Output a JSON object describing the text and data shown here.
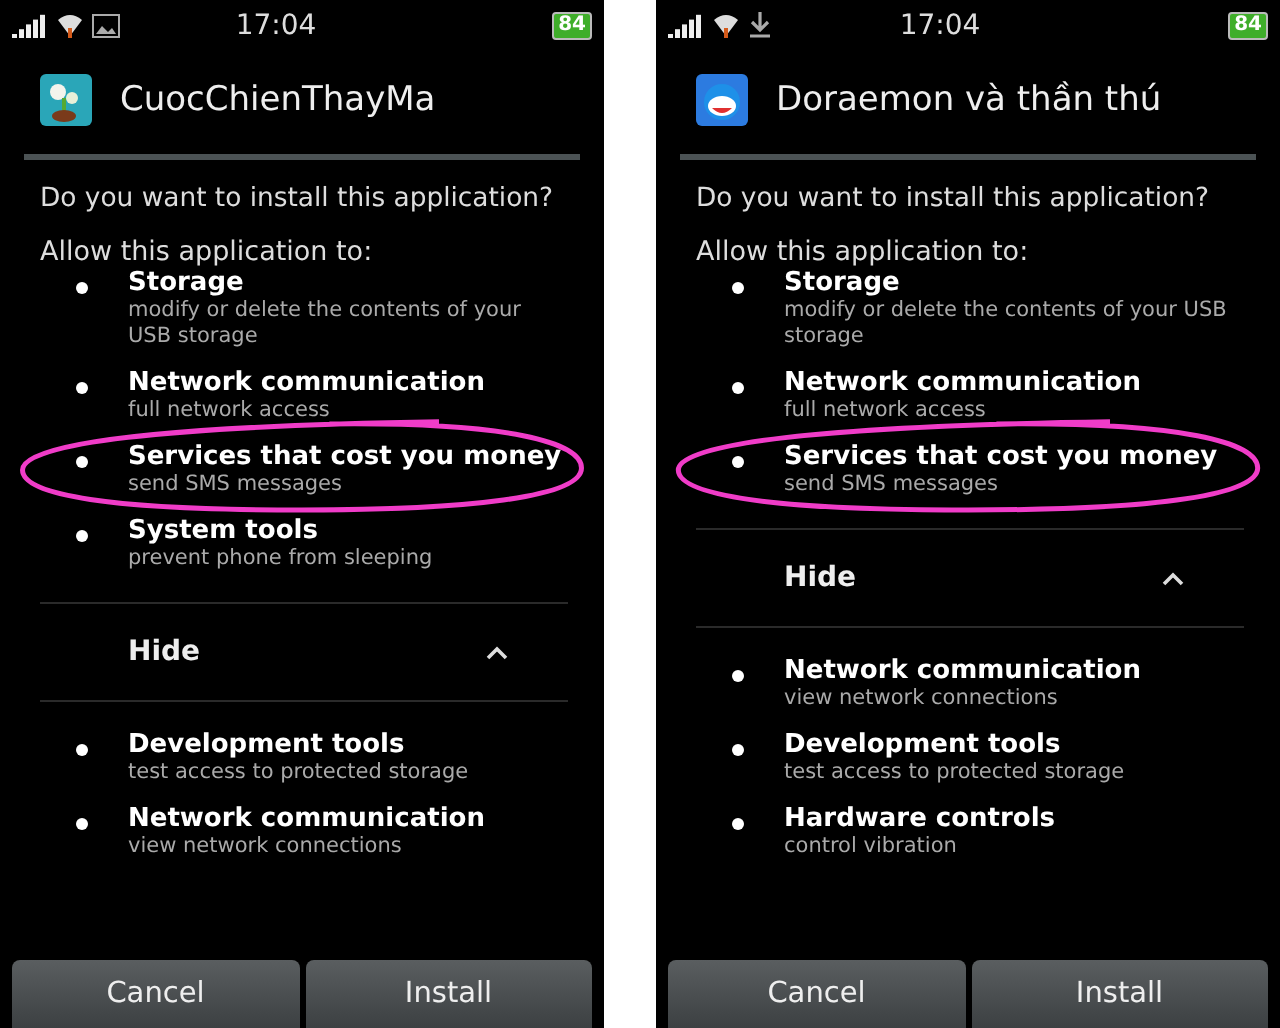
{
  "phones": [
    {
      "status_bar": {
        "time": "17:04",
        "battery": "84"
      },
      "app": {
        "name": "CuocChienThayMa"
      },
      "question": "Do you want to install this application?",
      "allow_label": "Allow this application to:",
      "permissions": [
        {
          "title": "Storage",
          "description": "modify or delete the contents of your USB storage",
          "circled": false
        },
        {
          "title": "Network communication",
          "description": "full network access",
          "circled": false
        },
        {
          "title": "Services that cost you money",
          "description": "send SMS messages",
          "circled": true
        },
        {
          "title": "System tools",
          "description": "prevent phone from sleeping",
          "circled": false
        }
      ],
      "toggle": {
        "label": "Hide",
        "expanded": true
      },
      "more_permissions": [
        {
          "title": "Development tools",
          "description": "test access to protected storage"
        },
        {
          "title": "Network communication",
          "description": "view network connections"
        }
      ],
      "buttons": [
        "Cancel",
        "Install"
      ]
    },
    {
      "status_bar": {
        "time": "17:04",
        "battery": "84"
      },
      "app": {
        "name": "Doraemon và thần thú"
      },
      "question": "Do you want to install this application?",
      "allow_label": "Allow this application to:",
      "permissions": [
        {
          "title": "Storage",
          "description": "modify or delete the contents of your USB storage",
          "circled": false
        },
        {
          "title": "Network communication",
          "description": "full network access",
          "circled": false
        },
        {
          "title": "Services that cost you money",
          "description": "send SMS messages",
          "circled": true
        }
      ],
      "toggle": {
        "label": "Hide",
        "expanded": true
      },
      "more_permissions": [
        {
          "title": "Network communication",
          "description": "view network connections"
        },
        {
          "title": "Development tools",
          "description": "test access to protected storage"
        },
        {
          "title": "Hardware controls",
          "description": "control vibration"
        }
      ],
      "buttons": [
        "Cancel",
        "Install"
      ]
    }
  ]
}
